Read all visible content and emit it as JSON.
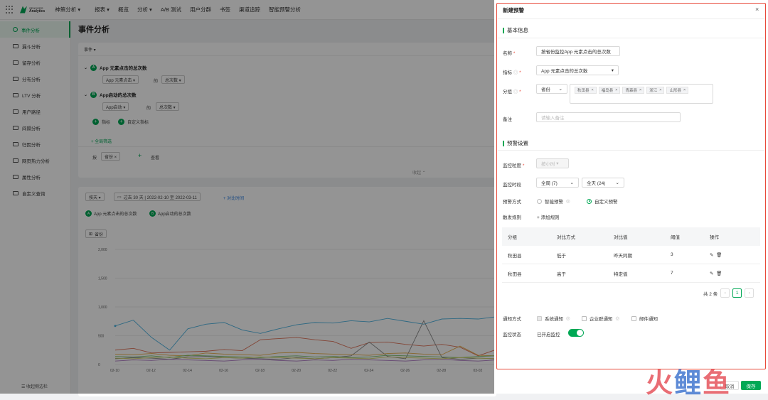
{
  "topnav": {
    "brand_top": "SENSORS",
    "brand_bottom": "Analytics",
    "project": "神策分析 ▾",
    "items": [
      "报表 ▾",
      "概览",
      "分析 ▾",
      "A/B 测试",
      "用户分群",
      "书签",
      "渠道追踪",
      "智能预警分析"
    ]
  },
  "sidebar": {
    "items": [
      {
        "label": "事件分析",
        "icon": "event-icon",
        "active": true
      },
      {
        "label": "漏斗分析",
        "icon": "funnel-icon"
      },
      {
        "label": "留存分析",
        "icon": "retention-icon"
      },
      {
        "label": "分布分析",
        "icon": "distribution-icon"
      },
      {
        "label": "LTV 分析",
        "icon": "ltv-icon"
      },
      {
        "label": "用户路径",
        "icon": "path-icon"
      },
      {
        "label": "间隔分析",
        "icon": "interval-icon"
      },
      {
        "label": "归因分析",
        "icon": "attribution-icon"
      },
      {
        "label": "网页热力分析",
        "icon": "heatmap-icon"
      },
      {
        "label": "属性分析",
        "icon": "property-icon"
      },
      {
        "label": "自定义查询",
        "icon": "query-icon"
      }
    ],
    "collapse": "☰ 收起侧边栏"
  },
  "main": {
    "title": "事件分析",
    "event_label": "事件 ▾",
    "metric_a": {
      "name": "App 元素点击的总次数",
      "event": "App 元素点击 ▾",
      "of": "的",
      "agg": "总次数 ▾"
    },
    "metric_b": {
      "name": "App启动的总次数",
      "event": "App启动 ▾",
      "of": "的",
      "agg": "总次数 ▾"
    },
    "add_metric": "指标",
    "add_custom": "自定义指标",
    "global_filter": "+ 全局筛选",
    "by_label": "按",
    "group_by": "省份 ×",
    "view": "查看",
    "collapse_label": "收起 ⌃",
    "granularity": "按天 ▾",
    "date_range": "过去 30 天 | 2022-02-10 至 2022-03-11",
    "compare": "+ 对比时间",
    "legend_a": "App 元素点击的总次数",
    "legend_b": "App启动的总次数",
    "chart_group": "省份"
  },
  "chart_data": {
    "type": "line",
    "x": [
      "02-10",
      "02-11",
      "02-12",
      "02-13",
      "02-14",
      "02-15",
      "02-16",
      "02-17",
      "02-18",
      "02-19",
      "02-20",
      "02-21",
      "02-22",
      "02-23",
      "02-24",
      "02-25",
      "02-26",
      "02-27",
      "02-28",
      "03-01",
      "03-02",
      "03-03"
    ],
    "x_tick_labels": [
      "02-10",
      "02-12",
      "02-14",
      "02-16",
      "02-18",
      "02-20",
      "02-22",
      "02-24",
      "02-26",
      "02-28",
      "03-02"
    ],
    "ylim": [
      0,
      2000
    ],
    "yticks": [
      "2,000",
      "1,500",
      "1,000",
      "500",
      "0"
    ],
    "series": [
      {
        "color": "#4fb3e0",
        "values": [
          670,
          770,
          470,
          250,
          620,
          700,
          730,
          600,
          540,
          620,
          690,
          730,
          720,
          760,
          740,
          800,
          750,
          700,
          790,
          800,
          790,
          830
        ]
      },
      {
        "color": "#e0745a",
        "values": [
          250,
          280,
          200,
          210,
          220,
          230,
          260,
          240,
          430,
          450,
          470,
          430,
          400,
          280,
          380,
          390,
          350,
          320,
          350,
          300,
          150,
          260
        ]
      },
      {
        "color": "#888888",
        "values": [
          100,
          120,
          110,
          90,
          130,
          140,
          120,
          110,
          100,
          90,
          120,
          100,
          120,
          150,
          390,
          140,
          100,
          760,
          120,
          90,
          110,
          100
        ]
      },
      {
        "color": "#e8b04a",
        "values": [
          180,
          170,
          190,
          160,
          150,
          200,
          180,
          170,
          160,
          200,
          210,
          190,
          180,
          170,
          160,
          190,
          200,
          180,
          170,
          320,
          160,
          150
        ]
      },
      {
        "color": "#7cc36e",
        "values": [
          140,
          130,
          150,
          120,
          160,
          150,
          140,
          130,
          120,
          140,
          150,
          130,
          140,
          120,
          130,
          160,
          150,
          140,
          130,
          120,
          140,
          150
        ]
      },
      {
        "color": "#b07cc6",
        "values": [
          60,
          80,
          70,
          90,
          80,
          70,
          60,
          80,
          90,
          70,
          60,
          80,
          70,
          90,
          80,
          70,
          60,
          80,
          90,
          70,
          60,
          80
        ]
      },
      {
        "color": "#d4d46a",
        "values": [
          110,
          100,
          120,
          130,
          110,
          100,
          120,
          110,
          130,
          120,
          110,
          100,
          120,
          110,
          100,
          130,
          120,
          110,
          100,
          120,
          110,
          100
        ]
      }
    ]
  },
  "drawer": {
    "title": "新建预警",
    "section_basic": "基本信息",
    "name_label": "名称",
    "name_value": "按省份监控App 元素点击的总次数",
    "metric_label": "指标",
    "metric_value": "App 元素点击的总次数",
    "group_label": "分组",
    "group_field": "省份",
    "group_tags": [
      "秋田县",
      "福岛县",
      "青森县",
      "浙江",
      "山形县"
    ],
    "note_label": "备注",
    "note_placeholder": "请输入备注",
    "section_alert": "预警设置",
    "granularity_label": "监控粒度",
    "granularity_value": "按小时",
    "period_label": "监控时段",
    "period_week": "全周 (7)",
    "period_day": "全天 (24)",
    "method_label": "预警方式",
    "method_smart": "智能预警",
    "method_custom": "自定义预警",
    "rule_label": "触发规则",
    "add_rule": "+ 添加规则",
    "table_headers": [
      "分组",
      "对比方式",
      "对比值",
      "阈值",
      "操作"
    ],
    "rows": [
      {
        "group": "秋田县",
        "mode": "低于",
        "compare": "昨天同期",
        "threshold": "3"
      },
      {
        "group": "秋田县",
        "mode": "高于",
        "compare": "特定值",
        "threshold": "7"
      }
    ],
    "total": "共 2 条",
    "page": "1",
    "notify_label": "通知方式",
    "notify_system": "系统通知",
    "notify_group": "企业群通知",
    "notify_mail": "邮件通知",
    "status_label": "监控状态",
    "status_value": "已开启监控",
    "cancel": "取消",
    "save": "保存"
  },
  "watermark": {
    "part1": "火",
    "part2": "鲤",
    "part3": "鱼"
  }
}
